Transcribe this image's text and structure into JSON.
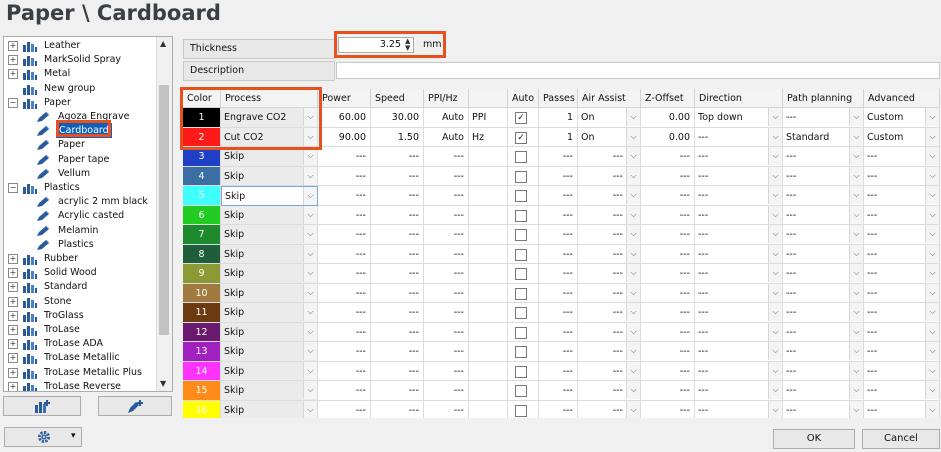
{
  "window": {
    "title": "Paper \\ Cardboard"
  },
  "tree": {
    "items": [
      {
        "label": "Leather",
        "level": 0,
        "expander": "+",
        "icon": "folder-icon"
      },
      {
        "label": "MarkSolid Spray",
        "level": 0,
        "expander": "+",
        "icon": "folder-icon"
      },
      {
        "label": "Metal",
        "level": 0,
        "expander": "+",
        "icon": "folder-icon"
      },
      {
        "label": "New group",
        "level": 0,
        "expander": "",
        "icon": "folder-icon"
      },
      {
        "label": "Paper",
        "level": 0,
        "expander": "−",
        "icon": "folder-icon"
      },
      {
        "label": "Agoza Engrave",
        "level": 1,
        "expander": "",
        "icon": "pen-icon"
      },
      {
        "label": "Cardboard",
        "level": 1,
        "expander": "",
        "icon": "pen-icon",
        "selected": true
      },
      {
        "label": "Paper",
        "level": 1,
        "expander": "",
        "icon": "pen-icon"
      },
      {
        "label": "Paper tape",
        "level": 1,
        "expander": "",
        "icon": "pen-icon"
      },
      {
        "label": "Vellum",
        "level": 1,
        "expander": "",
        "icon": "pen-icon"
      },
      {
        "label": "Plastics",
        "level": 0,
        "expander": "−",
        "icon": "folder-icon"
      },
      {
        "label": "acrylic 2 mm black",
        "level": 1,
        "expander": "",
        "icon": "pen-icon"
      },
      {
        "label": "Acrylic casted",
        "level": 1,
        "expander": "",
        "icon": "pen-icon"
      },
      {
        "label": "Melamin",
        "level": 1,
        "expander": "",
        "icon": "pen-icon"
      },
      {
        "label": "Plastics",
        "level": 1,
        "expander": "",
        "icon": "pen-icon"
      },
      {
        "label": "Rubber",
        "level": 0,
        "expander": "+",
        "icon": "folder-icon"
      },
      {
        "label": "Solid Wood",
        "level": 0,
        "expander": "+",
        "icon": "folder-icon"
      },
      {
        "label": "Standard",
        "level": 0,
        "expander": "+",
        "icon": "folder-icon"
      },
      {
        "label": "Stone",
        "level": 0,
        "expander": "+",
        "icon": "folder-icon"
      },
      {
        "label": "TroGlass",
        "level": 0,
        "expander": "+",
        "icon": "folder-icon"
      },
      {
        "label": "TroLase",
        "level": 0,
        "expander": "+",
        "icon": "folder-icon"
      },
      {
        "label": "TroLase ADA",
        "level": 0,
        "expander": "+",
        "icon": "folder-icon"
      },
      {
        "label": "TroLase Metallic",
        "level": 0,
        "expander": "+",
        "icon": "folder-icon"
      },
      {
        "label": "TroLase Metallic Plus",
        "level": 0,
        "expander": "+",
        "icon": "folder-icon"
      },
      {
        "label": "TroLase Reverse",
        "level": 0,
        "expander": "+",
        "icon": "folder-icon"
      }
    ],
    "scroll_up": "▲",
    "scroll_down": "▼"
  },
  "properties": {
    "thickness_label": "Thickness",
    "thickness_value": "3.25",
    "thickness_unit": "mm",
    "description_label": "Description",
    "description_value": ""
  },
  "grid": {
    "columns": [
      "Color",
      "Process",
      "Power",
      "Speed",
      "PPI/Hz",
      "",
      "Auto",
      "Passes",
      "Air Assist",
      "Z-Offset",
      "Direction",
      "Path planning",
      "Advanced"
    ],
    "rows": [
      {
        "num": "1",
        "color": "#000000",
        "process": "Engrave CO2",
        "power": "60.00",
        "speed": "30.00",
        "ppi": "Auto",
        "unit": "PPI",
        "auto": true,
        "passes": "1",
        "air": "On",
        "z": "0.00",
        "direction": "Top down",
        "path": "---",
        "advanced": "Custom"
      },
      {
        "num": "2",
        "color": "#ff1a1a",
        "process": "Cut CO2",
        "power": "90.00",
        "speed": "1.50",
        "ppi": "Auto",
        "unit": "Hz",
        "auto": true,
        "passes": "1",
        "air": "On",
        "z": "0.00",
        "direction": "---",
        "path": "Standard",
        "advanced": "Custom"
      },
      {
        "num": "3",
        "color": "#1f3fc4",
        "process": "Skip",
        "power": "---",
        "speed": "---",
        "ppi": "---",
        "unit": "",
        "auto": false,
        "passes": "---",
        "air": "---",
        "z": "---",
        "direction": "---",
        "path": "---",
        "advanced": "---"
      },
      {
        "num": "4",
        "color": "#3a6ea5",
        "process": "Skip",
        "power": "---",
        "speed": "---",
        "ppi": "---",
        "unit": "",
        "auto": false,
        "passes": "---",
        "air": "---",
        "z": "---",
        "direction": "---",
        "path": "---",
        "advanced": "---"
      },
      {
        "num": "5",
        "color": "#40ffff",
        "process": "Skip",
        "power": "---",
        "speed": "---",
        "ppi": "---",
        "unit": "",
        "auto": false,
        "passes": "---",
        "air": "---",
        "z": "---",
        "direction": "---",
        "path": "---",
        "advanced": "---"
      },
      {
        "num": "6",
        "color": "#22cc22",
        "process": "Skip",
        "power": "---",
        "speed": "---",
        "ppi": "---",
        "unit": "",
        "auto": false,
        "passes": "---",
        "air": "---",
        "z": "---",
        "direction": "---",
        "path": "---",
        "advanced": "---"
      },
      {
        "num": "7",
        "color": "#1e8a2e",
        "process": "Skip",
        "power": "---",
        "speed": "---",
        "ppi": "---",
        "unit": "",
        "auto": false,
        "passes": "---",
        "air": "---",
        "z": "---",
        "direction": "---",
        "path": "---",
        "advanced": "---"
      },
      {
        "num": "8",
        "color": "#1f5e3a",
        "process": "Skip",
        "power": "---",
        "speed": "---",
        "ppi": "---",
        "unit": "",
        "auto": false,
        "passes": "---",
        "air": "---",
        "z": "---",
        "direction": "---",
        "path": "---",
        "advanced": "---"
      },
      {
        "num": "9",
        "color": "#8c9a36",
        "process": "Skip",
        "power": "---",
        "speed": "---",
        "ppi": "---",
        "unit": "",
        "auto": false,
        "passes": "---",
        "air": "---",
        "z": "---",
        "direction": "---",
        "path": "---",
        "advanced": "---"
      },
      {
        "num": "10",
        "color": "#a07a40",
        "process": "Skip",
        "power": "---",
        "speed": "---",
        "ppi": "---",
        "unit": "",
        "auto": false,
        "passes": "---",
        "air": "---",
        "z": "---",
        "direction": "---",
        "path": "---",
        "advanced": "---"
      },
      {
        "num": "11",
        "color": "#6b3a10",
        "process": "Skip",
        "power": "---",
        "speed": "---",
        "ppi": "---",
        "unit": "",
        "auto": false,
        "passes": "---",
        "air": "---",
        "z": "---",
        "direction": "---",
        "path": "---",
        "advanced": "---"
      },
      {
        "num": "12",
        "color": "#6a1a6e",
        "process": "Skip",
        "power": "---",
        "speed": "---",
        "ppi": "---",
        "unit": "",
        "auto": false,
        "passes": "---",
        "air": "---",
        "z": "---",
        "direction": "---",
        "path": "---",
        "advanced": "---"
      },
      {
        "num": "13",
        "color": "#a020c0",
        "process": "Skip",
        "power": "---",
        "speed": "---",
        "ppi": "---",
        "unit": "",
        "auto": false,
        "passes": "---",
        "air": "---",
        "z": "---",
        "direction": "---",
        "path": "---",
        "advanced": "---"
      },
      {
        "num": "14",
        "color": "#ff33ff",
        "process": "Skip",
        "power": "---",
        "speed": "---",
        "ppi": "---",
        "unit": "",
        "auto": false,
        "passes": "---",
        "air": "---",
        "z": "---",
        "direction": "---",
        "path": "---",
        "advanced": "---"
      },
      {
        "num": "15",
        "color": "#ff8c1a",
        "process": "Skip",
        "power": "---",
        "speed": "---",
        "ppi": "---",
        "unit": "",
        "auto": false,
        "passes": "---",
        "air": "---",
        "z": "---",
        "direction": "---",
        "path": "---",
        "advanced": "---"
      },
      {
        "num": "16",
        "color": "#ffff00",
        "process": "Skip",
        "power": "---",
        "speed": "---",
        "ppi": "---",
        "unit": "",
        "auto": false,
        "passes": "---",
        "air": "---",
        "z": "---",
        "direction": "---",
        "path": "---",
        "advanced": "---"
      }
    ]
  },
  "buttons": {
    "ok": "OK",
    "cancel": "Cancel",
    "dropdown_glyph": "▾",
    "chevron_glyph": "⌵",
    "check_glyph": "✓"
  },
  "colors": {
    "accent": "#e8501e",
    "selection": "#0f5fb8"
  }
}
